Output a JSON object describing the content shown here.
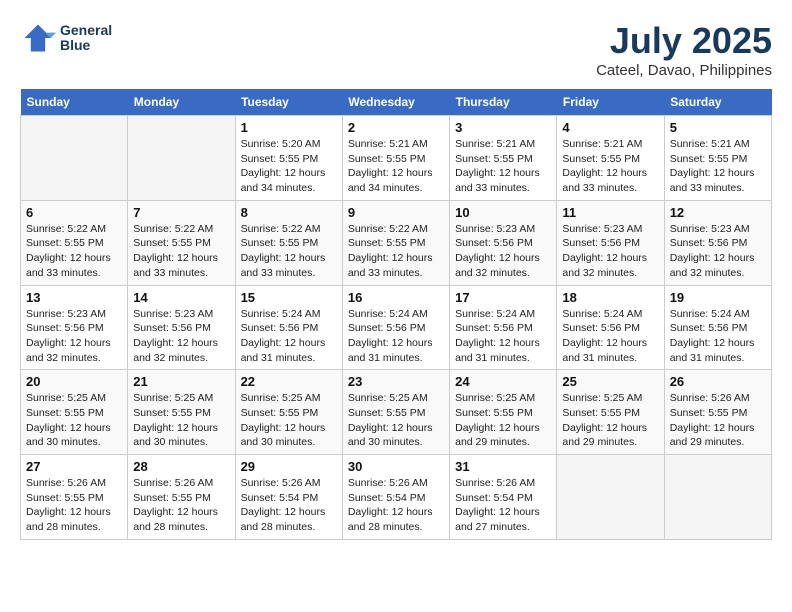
{
  "header": {
    "logo_line1": "General",
    "logo_line2": "Blue",
    "month_year": "July 2025",
    "location": "Cateel, Davao, Philippines"
  },
  "days_of_week": [
    "Sunday",
    "Monday",
    "Tuesday",
    "Wednesday",
    "Thursday",
    "Friday",
    "Saturday"
  ],
  "weeks": [
    [
      {
        "day": "",
        "empty": true
      },
      {
        "day": "",
        "empty": true
      },
      {
        "day": "1",
        "sunrise": "5:20 AM",
        "sunset": "5:55 PM",
        "daylight": "12 hours and 34 minutes."
      },
      {
        "day": "2",
        "sunrise": "5:21 AM",
        "sunset": "5:55 PM",
        "daylight": "12 hours and 34 minutes."
      },
      {
        "day": "3",
        "sunrise": "5:21 AM",
        "sunset": "5:55 PM",
        "daylight": "12 hours and 33 minutes."
      },
      {
        "day": "4",
        "sunrise": "5:21 AM",
        "sunset": "5:55 PM",
        "daylight": "12 hours and 33 minutes."
      },
      {
        "day": "5",
        "sunrise": "5:21 AM",
        "sunset": "5:55 PM",
        "daylight": "12 hours and 33 minutes."
      }
    ],
    [
      {
        "day": "6",
        "sunrise": "5:22 AM",
        "sunset": "5:55 PM",
        "daylight": "12 hours and 33 minutes."
      },
      {
        "day": "7",
        "sunrise": "5:22 AM",
        "sunset": "5:55 PM",
        "daylight": "12 hours and 33 minutes."
      },
      {
        "day": "8",
        "sunrise": "5:22 AM",
        "sunset": "5:55 PM",
        "daylight": "12 hours and 33 minutes."
      },
      {
        "day": "9",
        "sunrise": "5:22 AM",
        "sunset": "5:55 PM",
        "daylight": "12 hours and 33 minutes."
      },
      {
        "day": "10",
        "sunrise": "5:23 AM",
        "sunset": "5:56 PM",
        "daylight": "12 hours and 32 minutes."
      },
      {
        "day": "11",
        "sunrise": "5:23 AM",
        "sunset": "5:56 PM",
        "daylight": "12 hours and 32 minutes."
      },
      {
        "day": "12",
        "sunrise": "5:23 AM",
        "sunset": "5:56 PM",
        "daylight": "12 hours and 32 minutes."
      }
    ],
    [
      {
        "day": "13",
        "sunrise": "5:23 AM",
        "sunset": "5:56 PM",
        "daylight": "12 hours and 32 minutes."
      },
      {
        "day": "14",
        "sunrise": "5:23 AM",
        "sunset": "5:56 PM",
        "daylight": "12 hours and 32 minutes."
      },
      {
        "day": "15",
        "sunrise": "5:24 AM",
        "sunset": "5:56 PM",
        "daylight": "12 hours and 31 minutes."
      },
      {
        "day": "16",
        "sunrise": "5:24 AM",
        "sunset": "5:56 PM",
        "daylight": "12 hours and 31 minutes."
      },
      {
        "day": "17",
        "sunrise": "5:24 AM",
        "sunset": "5:56 PM",
        "daylight": "12 hours and 31 minutes."
      },
      {
        "day": "18",
        "sunrise": "5:24 AM",
        "sunset": "5:56 PM",
        "daylight": "12 hours and 31 minutes."
      },
      {
        "day": "19",
        "sunrise": "5:24 AM",
        "sunset": "5:56 PM",
        "daylight": "12 hours and 31 minutes."
      }
    ],
    [
      {
        "day": "20",
        "sunrise": "5:25 AM",
        "sunset": "5:55 PM",
        "daylight": "12 hours and 30 minutes."
      },
      {
        "day": "21",
        "sunrise": "5:25 AM",
        "sunset": "5:55 PM",
        "daylight": "12 hours and 30 minutes."
      },
      {
        "day": "22",
        "sunrise": "5:25 AM",
        "sunset": "5:55 PM",
        "daylight": "12 hours and 30 minutes."
      },
      {
        "day": "23",
        "sunrise": "5:25 AM",
        "sunset": "5:55 PM",
        "daylight": "12 hours and 30 minutes."
      },
      {
        "day": "24",
        "sunrise": "5:25 AM",
        "sunset": "5:55 PM",
        "daylight": "12 hours and 29 minutes."
      },
      {
        "day": "25",
        "sunrise": "5:25 AM",
        "sunset": "5:55 PM",
        "daylight": "12 hours and 29 minutes."
      },
      {
        "day": "26",
        "sunrise": "5:26 AM",
        "sunset": "5:55 PM",
        "daylight": "12 hours and 29 minutes."
      }
    ],
    [
      {
        "day": "27",
        "sunrise": "5:26 AM",
        "sunset": "5:55 PM",
        "daylight": "12 hours and 28 minutes."
      },
      {
        "day": "28",
        "sunrise": "5:26 AM",
        "sunset": "5:55 PM",
        "daylight": "12 hours and 28 minutes."
      },
      {
        "day": "29",
        "sunrise": "5:26 AM",
        "sunset": "5:54 PM",
        "daylight": "12 hours and 28 minutes."
      },
      {
        "day": "30",
        "sunrise": "5:26 AM",
        "sunset": "5:54 PM",
        "daylight": "12 hours and 28 minutes."
      },
      {
        "day": "31",
        "sunrise": "5:26 AM",
        "sunset": "5:54 PM",
        "daylight": "12 hours and 27 minutes."
      },
      {
        "day": "",
        "empty": true
      },
      {
        "day": "",
        "empty": true
      }
    ]
  ],
  "labels": {
    "sunrise": "Sunrise:",
    "sunset": "Sunset:",
    "daylight": "Daylight:"
  }
}
